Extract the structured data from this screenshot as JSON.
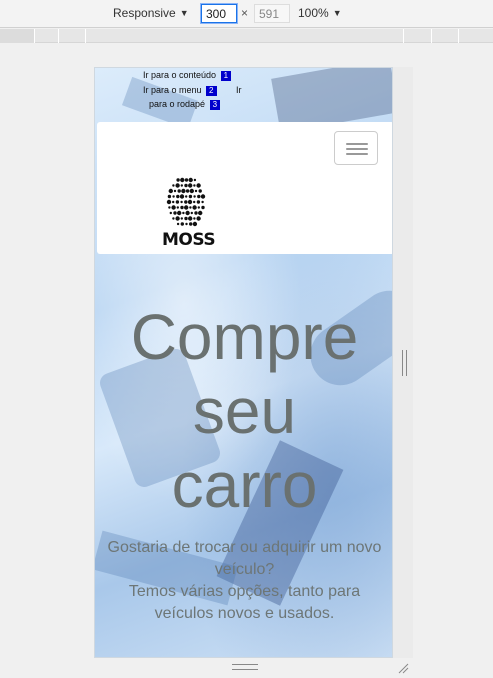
{
  "devtools": {
    "device_preset": "Responsive",
    "width_value": "300",
    "height_value": "591",
    "times": "×",
    "zoom": "100%"
  },
  "site": {
    "skip_links": [
      {
        "label": "Ir para o conteúdo",
        "key": "1"
      },
      {
        "label": "Ir para o menu",
        "key": "2"
      },
      {
        "label": "Ir",
        "key": ""
      },
      {
        "label": "para o rodapé",
        "key": "3"
      }
    ],
    "logo_text": "MOSS",
    "hero_title": "Compre seu carro",
    "hero_text_line1": "Gostaria de trocar ou adquirir um novo veículo?",
    "hero_text_line2": "Temos várias opções, tanto para veículos novos e usados."
  },
  "icons": {
    "menu_toggle": "hamburger-icon",
    "preset_dropdown": "chevron-down-icon",
    "zoom_dropdown": "chevron-down-icon"
  }
}
